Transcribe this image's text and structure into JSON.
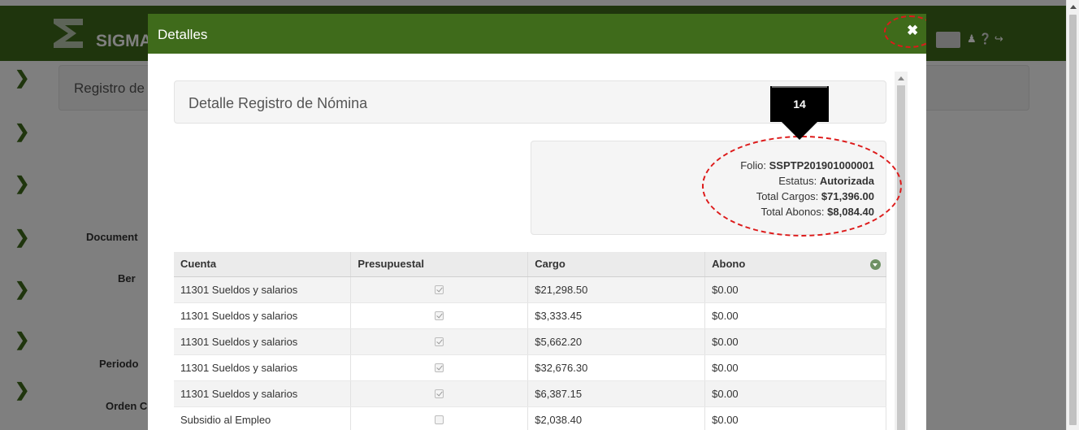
{
  "background": {
    "brand": "SIGMA",
    "breadcrumb": "Registro de",
    "labels": [
      "Document",
      "Ber",
      "Periodo",
      "Orden C"
    ],
    "sidebar_icon": "chevron-right-icon",
    "user_icons": "user-icon help-icon logout-icon"
  },
  "modal": {
    "title": "Detalles",
    "close_icon": "close-icon",
    "panel_heading": "Detalle Registro de Nómina",
    "step_badge": "14",
    "summary": {
      "folio_label": "Folio:",
      "folio_value": "SSPTP201901000001",
      "estatus_label": "Estatus:",
      "estatus_value": "Autorizada",
      "cargos_label": "Total Cargos:",
      "cargos_value": "$71,396.00",
      "abonos_label": "Total Abonos:",
      "abonos_value": "$8,084.40"
    },
    "table": {
      "headers": [
        "Cuenta",
        "Presupuestal",
        "Cargo",
        "Abono"
      ],
      "rows": [
        {
          "cuenta": "11301 Sueldos y salarios",
          "presupuestal": true,
          "cargo": "$21,298.50",
          "abono": "$0.00"
        },
        {
          "cuenta": "11301 Sueldos y salarios",
          "presupuestal": true,
          "cargo": "$3,333.45",
          "abono": "$0.00"
        },
        {
          "cuenta": "11301 Sueldos y salarios",
          "presupuestal": true,
          "cargo": "$5,662.20",
          "abono": "$0.00"
        },
        {
          "cuenta": "11301 Sueldos y salarios",
          "presupuestal": true,
          "cargo": "$32,676.30",
          "abono": "$0.00"
        },
        {
          "cuenta": "11301 Sueldos y salarios",
          "presupuestal": true,
          "cargo": "$6,387.15",
          "abono": "$0.00"
        },
        {
          "cuenta": "Subsidio al Empleo",
          "presupuestal": false,
          "cargo": "$2,038.40",
          "abono": "$0.00"
        }
      ]
    }
  },
  "colors": {
    "header_green": "#3f6b1b",
    "annotation_red": "#dd1a1a"
  }
}
